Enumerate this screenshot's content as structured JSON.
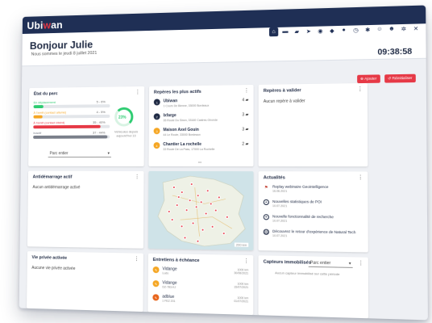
{
  "app": {
    "logo_prefix": "Ubi",
    "logo_accent": "w",
    "logo_suffix": "an"
  },
  "header": {
    "greeting": "Bonjour Julie",
    "date": "Nous sommes le jeudi 8 juillet 2021",
    "clock": "09:38:58",
    "nav_icons": [
      "home-icon",
      "truck-icon",
      "car-icon",
      "send-icon",
      "location-icon",
      "diamond-icon",
      "map-pin-icon",
      "alarm-icon",
      "tools-icon",
      "users-icon",
      "user-icon",
      "gear-icon",
      "close-icon"
    ]
  },
  "actions": {
    "ajouter": "Ajouter",
    "reinitialiser": "Réinitialiser"
  },
  "etat_parc": {
    "title": "État du parc",
    "rows": [
      {
        "label": "En déplacement",
        "pct_label": "5 - 6%",
        "fill": 0.06,
        "color": "#2ecc71"
      },
      {
        "label": "À l'arrêt (contact allumé)",
        "pct_label": "4 - 5%",
        "fill": 0.05,
        "color": "#f5a623"
      },
      {
        "label": "À l'arrêt (contact éteint)",
        "pct_label": "35 - 40%",
        "fill": 0.4,
        "color": "#e63946"
      },
      {
        "label": "Inactif",
        "pct_label": "37 - 44%",
        "fill": 0.44,
        "color": "#7a7f8a"
      }
    ],
    "ring_value": "23%",
    "ring_caption_1": "Véhicules depuis",
    "ring_caption_2": "aujourd'hui 13",
    "select_value": "Parc entier"
  },
  "reperes_actifs": {
    "title": "Repères les plus actifs",
    "items": [
      {
        "badge": "1",
        "name": "Ubiwan",
        "addr": "1 Cours De Bienne, 33000 Bordeaux",
        "count": "4"
      },
      {
        "badge": "2",
        "name": "Ixfarge",
        "addr": "35 Route Du Sinon, 33160 Castres-Gironde",
        "count": "3"
      },
      {
        "badge": "3",
        "name": "Maison Axel Gouin",
        "addr": "44 Le Route, 33000 Bordeaux",
        "count": "3"
      },
      {
        "badge": "4",
        "name": "Chantier La rochelle",
        "addr": "33 Route De La Pass, 17000 La Rochelle",
        "count": "2"
      }
    ]
  },
  "reperes_valider": {
    "title": "Repères à valider",
    "empty": "Aucun repère à valider"
  },
  "antidemarrage": {
    "title": "Antidémarrage actif",
    "empty": "Aucun antidémarrage activé"
  },
  "actualites": {
    "title": "Actualités",
    "items": [
      {
        "icon": "flag-icon",
        "title": "Replay webinaire Geointelligence",
        "date": "16.06.2021"
      },
      {
        "icon": "plus-icon",
        "title": "Nouvelles statistiques de POI",
        "date": "10.07.2021"
      },
      {
        "icon": "plus-icon",
        "title": "Nouvelle fonctionnalité de recherche",
        "date": "10.07.2021"
      },
      {
        "icon": "doc-icon",
        "title": "Découvrez le retour d'expérience de Natural Tech",
        "date": "10.07.2021"
      }
    ]
  },
  "vie_privee": {
    "title": "Vie privée activée",
    "empty": "Aucune vie privée activée"
  },
  "entretiens": {
    "title": "Entretiens à échéance",
    "items": [
      {
        "name": "Vidange",
        "sub": "Ludo",
        "km": "1000 km",
        "date": "30/06/2021"
      },
      {
        "name": "Vidange",
        "sub": "DZ-783-KJ",
        "km": "1000 km",
        "date": "15/07/2021"
      },
      {
        "name": "adblue",
        "sub": "1 FEZ 201",
        "km": "1000 km",
        "date": "01/07/2021"
      }
    ]
  },
  "capteurs": {
    "title": "Capteurs immobilisés",
    "select_value": "Parc entier",
    "empty": "Aucun capteur immobilisé sur cette période"
  },
  "map": {
    "scale": "200 km"
  }
}
